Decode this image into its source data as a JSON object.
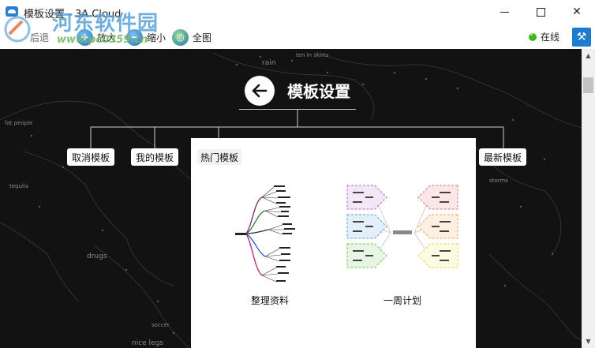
{
  "window": {
    "title": "模板设置 - 3A Cloud",
    "icons": {
      "app": "cloud-icon",
      "minimize": "minimize-icon",
      "maximize": "maximize-icon",
      "close": "close-icon"
    }
  },
  "watermark": {
    "name": "河东软件园",
    "url": "www.pc0359.cn"
  },
  "toolbar": {
    "back_label": "后退",
    "zoom_in_label": "放大",
    "zoom_out_label": "缩小",
    "full_label": "全图",
    "status_label": "在线",
    "icons": {
      "zoom_in": "zoom-in-icon",
      "zoom_out": "zoom-out-icon",
      "full": "globe-icon",
      "status": "check-icon",
      "tool": "hammer-icon"
    }
  },
  "page": {
    "title": "模板设置",
    "back_icon": "arrow-left-icon"
  },
  "tabs": [
    {
      "label": "取消模板"
    },
    {
      "label": "我的模板"
    },
    {
      "label": "热门模板",
      "active": true
    },
    {
      "label": "最新模板"
    }
  ],
  "templates": [
    {
      "label": "整理资料"
    },
    {
      "label": "一周计划"
    }
  ],
  "map_words": [
    "rain",
    "ten in skirts",
    "fat people",
    "tequila",
    "drugs",
    "soccer",
    "nice legs",
    "storms"
  ],
  "colors": {
    "canvas_bg": "#121212",
    "accent": "#1c7cd0",
    "online": "#41b51f"
  }
}
